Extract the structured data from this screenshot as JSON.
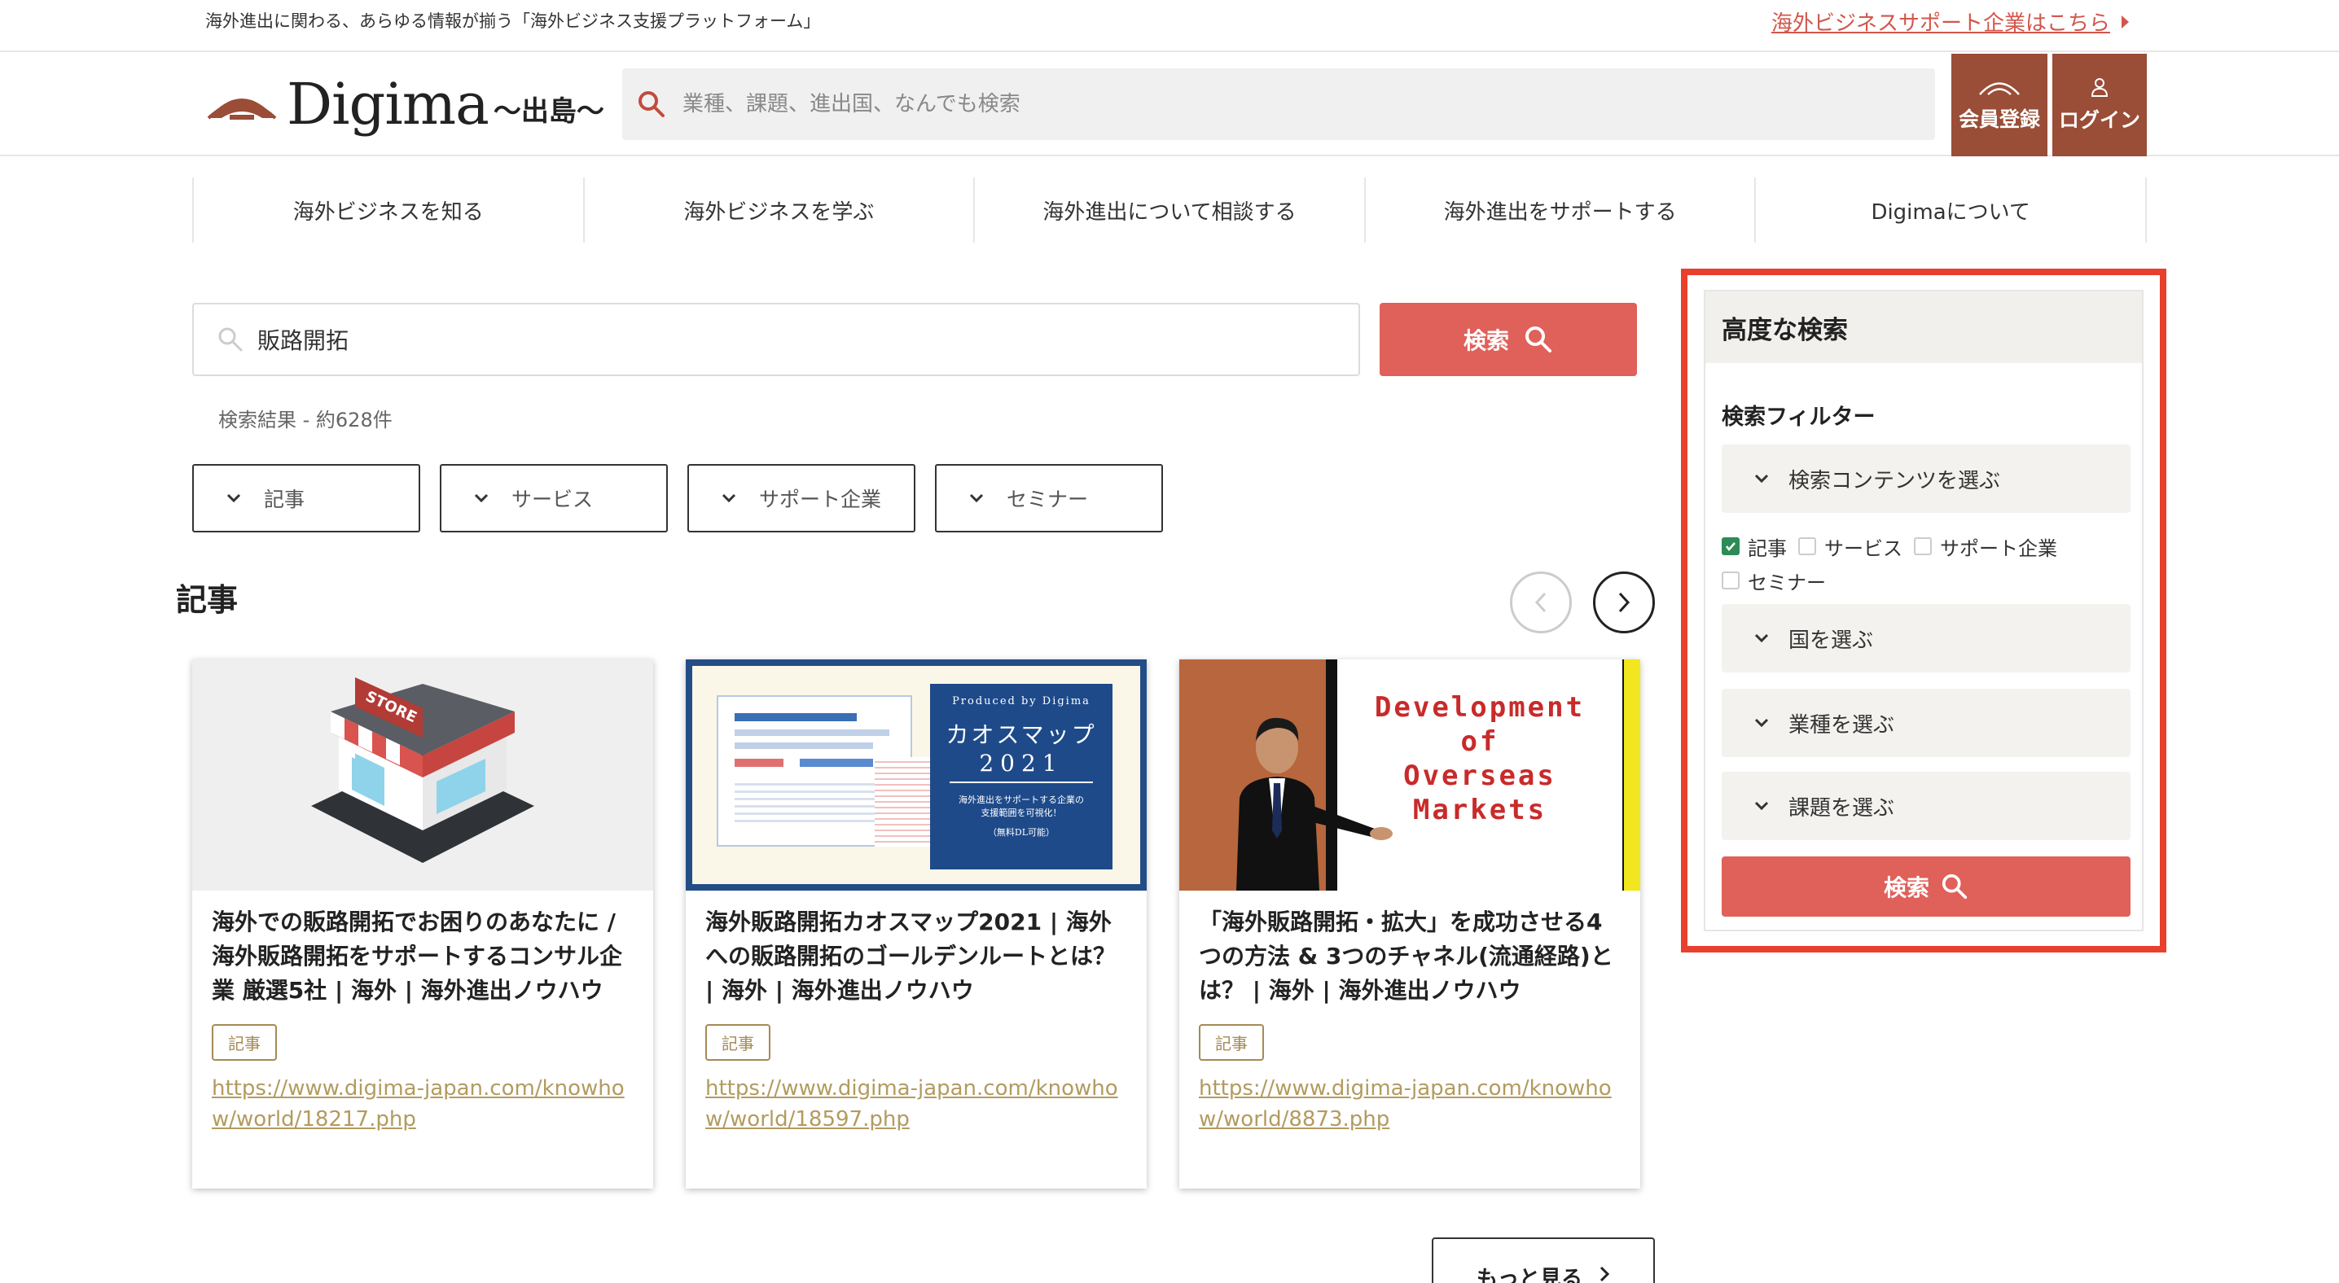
{
  "topbar": {
    "tagline": "海外進出に関わる、あらゆる情報が揃う「海外ビジネス支援プラットフォーム」",
    "support_link": "海外ビジネスサポート企業はこちら"
  },
  "header": {
    "logo_text": "Digima",
    "logo_sub": "〜出島〜",
    "search_placeholder": "業種、課題、進出国、なんでも検索",
    "register_label": "会員登録",
    "login_label": "ログイン"
  },
  "nav": {
    "items": [
      {
        "label": "海外ビジネスを知る"
      },
      {
        "label": "海外ビジネスを学ぶ"
      },
      {
        "label": "海外進出について相談する"
      },
      {
        "label": "海外進出をサポートする"
      },
      {
        "label": "Digimaについて"
      }
    ]
  },
  "search": {
    "query": "販路開拓",
    "button_label": "検索",
    "result_count": "検索結果 - 約628件",
    "filters": [
      {
        "label": "記事"
      },
      {
        "label": "サービス"
      },
      {
        "label": "サポート企業"
      },
      {
        "label": "セミナー"
      }
    ]
  },
  "articles": {
    "section_title": "記事",
    "more_label": "もっと見る",
    "items": [
      {
        "title": "海外での販路開拓でお困りのあなたに / 海外販路開拓をサポートするコンサル企業 厳選5社 | 海外 | 海外進出ノウハウ",
        "tag": "記事",
        "url": "https://www.digima-japan.com/knowhow/world/18217.php",
        "image_text": "STORE"
      },
      {
        "title": "海外販路開拓カオスマップ2021 | 海外への販路開拓のゴールデンルートとは？ | 海外 | 海外進出ノウハウ",
        "tag": "記事",
        "url": "https://www.digima-japan.com/knowhow/world/18597.php",
        "image_text": {
          "produced": "Produced by Digima",
          "main": "カオスマップ",
          "year": "2021",
          "desc1": "海外進出をサポートする企業の",
          "desc2": "支援範囲を可視化！",
          "note": "（無料DL可能）"
        }
      },
      {
        "title": "「海外販路開拓・拡大」を成功させる4つの方法 & 3つのチャネル(流通経路)とは？ | 海外 | 海外進出ノウハウ",
        "tag": "記事",
        "url": "https://www.digima-japan.com/knowhow/world/8873.php",
        "image_text": [
          "Development",
          "of",
          "Overseas",
          "Markets"
        ]
      }
    ]
  },
  "advanced": {
    "title": "高度な検索",
    "filter_title": "検索フィルター",
    "content_select": "検索コンテンツを選ぶ",
    "checkboxes": [
      {
        "label": "記事",
        "checked": true
      },
      {
        "label": "サービス",
        "checked": false
      },
      {
        "label": "サポート企業",
        "checked": false
      },
      {
        "label": "セミナー",
        "checked": false
      }
    ],
    "country_select": "国を選ぶ",
    "industry_select": "業種を選ぶ",
    "issue_select": "課題を選ぶ",
    "button_label": "検索"
  },
  "colors": {
    "brand_brown": "#9a4d37",
    "accent_red": "#e0605a",
    "highlight_border": "#e8402c",
    "link_gold": "#b39b5f",
    "checkbox_green": "#2e8b57"
  }
}
